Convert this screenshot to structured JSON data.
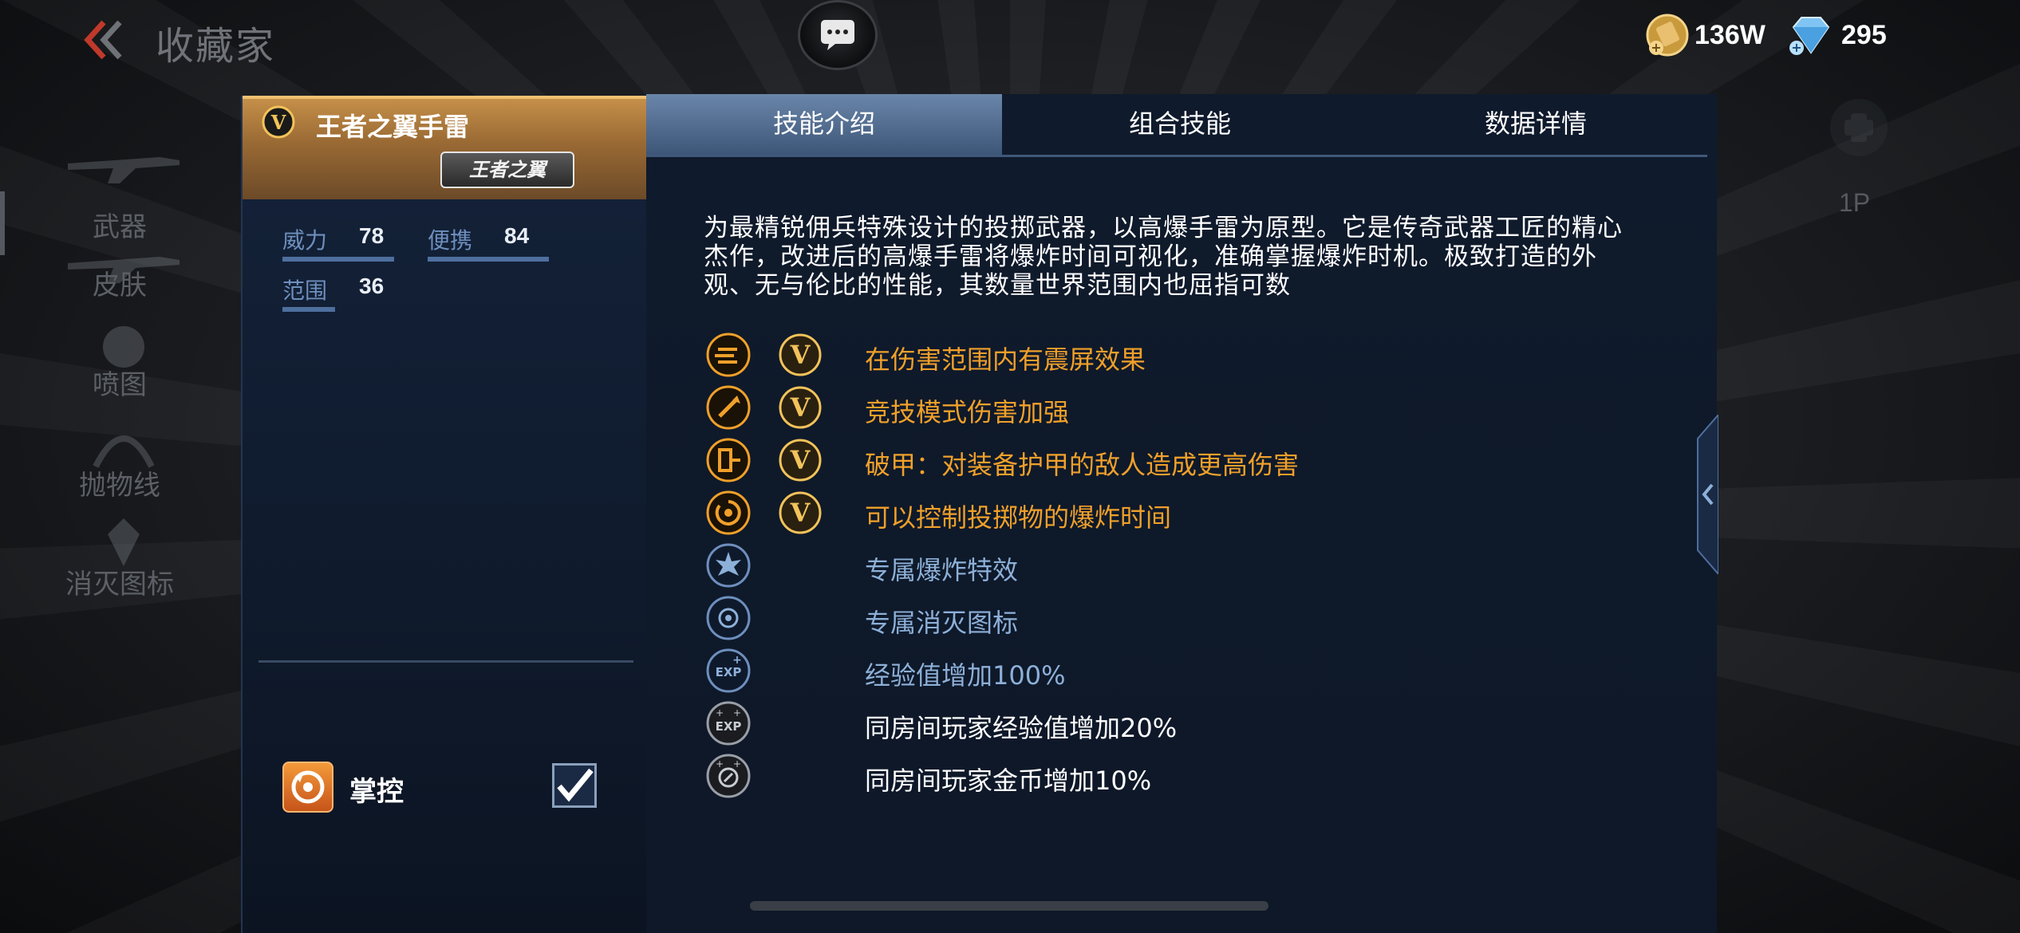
{
  "header": {
    "title": "收藏家",
    "currencies": [
      {
        "icon": "gold-coin-icon",
        "value": "136W"
      },
      {
        "icon": "diamond-icon",
        "value": "295"
      }
    ]
  },
  "sidebar": {
    "items": [
      {
        "label": "武器",
        "icon": "rifle-icon"
      },
      {
        "label": "皮肤",
        "icon": "rifle-skin-icon"
      },
      {
        "label": "喷图",
        "icon": "spray-icon"
      },
      {
        "label": "抛物线",
        "icon": "trajectory-icon"
      },
      {
        "label": "消灭图标",
        "icon": "kill-icon"
      }
    ]
  },
  "weapon": {
    "name": "王者之翼手雷",
    "badge": "王者之翼",
    "stats": [
      {
        "key": "威力",
        "value": "78"
      },
      {
        "key": "便携",
        "value": "84"
      },
      {
        "key": "范围",
        "value": "36"
      }
    ],
    "control": {
      "label": "掌控",
      "checked": true
    }
  },
  "tabs": [
    {
      "label": "技能介绍",
      "active": true
    },
    {
      "label": "组合技能",
      "active": false
    },
    {
      "label": "数据详情",
      "active": false
    }
  ],
  "description": "为最精锐佣兵特殊设计的投掷武器，以高爆手雷为原型。它是传奇武器工匠的精心杰作，改进后的高爆手雷将爆炸时间可视化，准确掌握爆炸时机。极致打造的外观、无与伦比的性能，其数量世界范围内也屈指可数",
  "features": [
    {
      "text": "在伤害范围内有震屏效果",
      "icon": "screen-shake-icon",
      "color": "gold",
      "v": true
    },
    {
      "text": "竞技模式伤害加强",
      "icon": "damage-up-icon",
      "color": "gold",
      "v": true
    },
    {
      "text": "破甲：对装备护甲的敌人造成更高伤害",
      "icon": "armor-break-icon",
      "color": "gold",
      "v": true
    },
    {
      "text": "可以控制投掷物的爆炸时间",
      "icon": "timer-control-icon",
      "color": "gold",
      "v": true
    },
    {
      "text": "专属爆炸特效",
      "icon": "explosion-effect-icon",
      "color": "blue",
      "v": false
    },
    {
      "text": "专属消灭图标",
      "icon": "kill-mark-icon",
      "color": "blue",
      "v": false
    },
    {
      "text": "经验值增加100%",
      "icon": "exp-bonus-icon",
      "color": "blue",
      "v": false
    },
    {
      "text": "同房间玩家经验值增加20%",
      "icon": "room-exp-icon",
      "color": "white",
      "v": false
    },
    {
      "text": "同房间玩家金币增加10%",
      "icon": "room-coin-icon",
      "color": "white",
      "v": false
    }
  ],
  "right_rail": {
    "label": "1P"
  },
  "colors": {
    "gold": "#f0a02a",
    "blue": "#8db0d8",
    "accent": "#6a86aa"
  }
}
